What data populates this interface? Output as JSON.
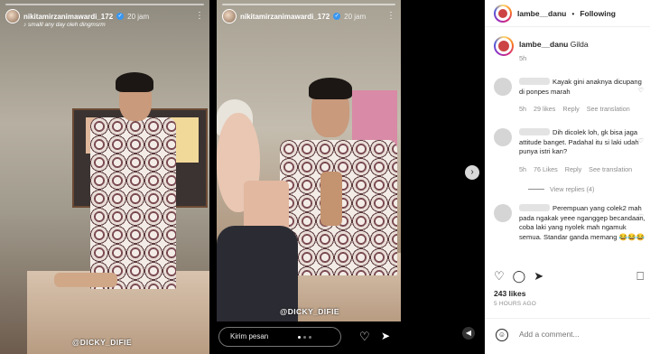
{
  "story_left": {
    "username": "nikitamirzanimawardi_172",
    "time": "20 jam",
    "music": "♪ smalll any day oleh dingmsrm",
    "watermark": "@DICKY_DIFIE"
  },
  "story_right": {
    "username": "nikitamirzanimawardi_172",
    "time": "20 jam",
    "watermark": "@DICKY_DIFIE",
    "reply_placeholder": "Kirim pesan"
  },
  "icons": {
    "more": "⋮",
    "next": "›",
    "mute": "◀",
    "heart": "♡",
    "send": "➤",
    "comment": "◯",
    "share": "➤",
    "save": "⎕",
    "emoji": "☺"
  },
  "post": {
    "header": {
      "username": "lambe__danu",
      "separator": "•",
      "follow_label": "Following"
    },
    "caption": {
      "username": "lambe__danu",
      "text": "Gilda",
      "age": "5h"
    },
    "comments": [
      {
        "text": "Kayak gini anaknya dicupang di ponpes marah",
        "age": "5h",
        "likes": "29 likes",
        "reply": "Reply",
        "translate": "See translation"
      },
      {
        "text": "Dih dicolek loh, gk bisa jaga attitude banget. Padahal itu si laki udah punya istri kan?",
        "age": "5h",
        "likes": "76 Likes",
        "reply": "Reply",
        "translate": "See translation"
      },
      {
        "text": "Perempuan yang colek2 mah pada ngakak yeee nganggep becandaan, coba laki yang nyolek mah ngamuk semua. Standar ganda memang 😂😂😂",
        "age": "",
        "likes": "",
        "reply": "",
        "translate": ""
      }
    ],
    "view_replies": "View replies (4)",
    "likes": "243 likes",
    "posted": "5 HOURS AGO",
    "add_comment_placeholder": "Add a comment..."
  }
}
